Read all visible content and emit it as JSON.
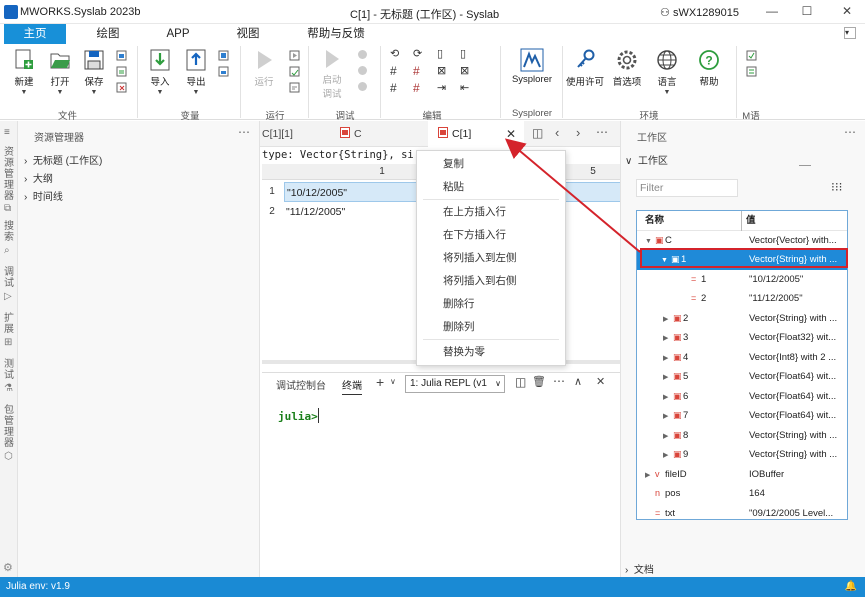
{
  "titlebar": {
    "app_title": "MWORKS.Syslab 2023b",
    "window_title": "C[1] - 无标题 (工作区) - Syslab",
    "user": "sWX1289015"
  },
  "ribbon_tabs": [
    "主页",
    "绘图",
    "APP",
    "视图",
    "帮助与反馈"
  ],
  "ribbon": {
    "groups": {
      "file": "文件",
      "variable": "变量",
      "run": "运行",
      "debug": "调试",
      "edit": "编辑",
      "sysplorer": "Sysplorer",
      "env": "环境",
      "m": "M语"
    },
    "buttons": {
      "new": "新建",
      "open": "打开",
      "save": "保存",
      "import": "导入",
      "export": "导出",
      "run": "运行",
      "start_debug_1": "启动",
      "start_debug_2": "调试",
      "sysplorer": "Sysplorer",
      "license": "使用许可",
      "prefs": "首选项",
      "language": "语言",
      "help": "帮助"
    }
  },
  "activitybar": [
    "资源管理器",
    "搜索",
    "调试",
    "扩展",
    "测试",
    "包管理器"
  ],
  "explorer": {
    "title": "资源管理器",
    "items": [
      "无标题 (工作区)",
      "大纲",
      "时间线"
    ]
  },
  "editor": {
    "tabs": [
      "C[1][1]",
      "C",
      "C[1]"
    ],
    "type_line": "type: Vector{String}, si",
    "col_headers": [
      "1",
      "5"
    ],
    "rows": [
      {
        "num": "1",
        "value": "\"10/12/2005\""
      },
      {
        "num": "2",
        "value": "\"11/12/2005\""
      }
    ]
  },
  "context_menu": {
    "items": [
      "复制",
      "粘贴",
      "在上方插入行",
      "在下方插入行",
      "将列插入到左侧",
      "将列插入到右侧",
      "删除行",
      "删除列",
      "替换为零"
    ]
  },
  "terminal": {
    "tabs": [
      "调试控制台",
      "终端"
    ],
    "repl_select": "1: Julia REPL (v1",
    "prompt": "julia>"
  },
  "workspace": {
    "panel_title": "工作区",
    "section_title": "工作区",
    "filter_placeholder": "Filter",
    "col_name": "名称",
    "col_value": "值",
    "rows": [
      {
        "name": "C",
        "value": "Vector{Vector} with..."
      },
      {
        "name": "1",
        "value": "Vector{String} with ..."
      },
      {
        "name": "1",
        "value": "\"10/12/2005\""
      },
      {
        "name": "2",
        "value": "\"11/12/2005\""
      },
      {
        "name": "2",
        "value": "Vector{String} with ..."
      },
      {
        "name": "3",
        "value": "Vector{Float32} wit..."
      },
      {
        "name": "4",
        "value": "Vector{Int8} with 2 ..."
      },
      {
        "name": "5",
        "value": "Vector{Float64} wit..."
      },
      {
        "name": "6",
        "value": "Vector{Float64} wit..."
      },
      {
        "name": "7",
        "value": "Vector{Float64} wit..."
      },
      {
        "name": "8",
        "value": "Vector{String} with ..."
      },
      {
        "name": "9",
        "value": "Vector{String} with ..."
      },
      {
        "name": "fileID",
        "value": "IOBuffer"
      },
      {
        "name": "pos",
        "value": "164"
      },
      {
        "name": "txt",
        "value": "\"09/12/2005 Level..."
      }
    ],
    "docs_label": "文档"
  },
  "statusbar": {
    "env": "Julia env: v1.9"
  },
  "colors": {
    "accent": "#1890d8",
    "status": "#1a8ad4",
    "highlight": "#d4232b"
  }
}
